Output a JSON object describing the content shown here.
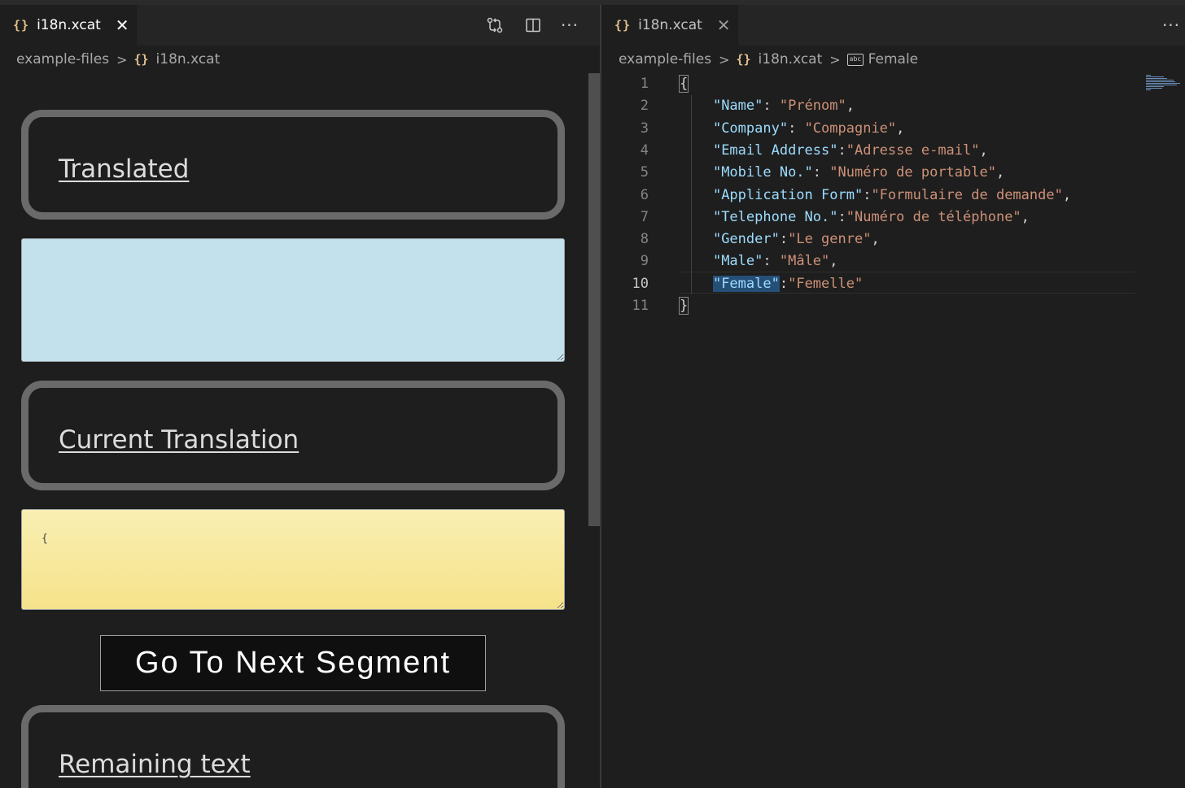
{
  "left": {
    "tab": {
      "icon": "json-braces-icon",
      "glyph": "{}",
      "label": "i18n.xcat",
      "close": "✕"
    },
    "actions": {
      "more": "···"
    },
    "breadcrumb": {
      "folder": "example-files",
      "file": "i18n.xcat",
      "separator": ">"
    },
    "webview": {
      "translated_label": "Translated",
      "translated_value": "",
      "current_label": "Current Translation",
      "current_value": "{",
      "next_button": "Go To Next Segment",
      "remaining_label": "Remaining text"
    }
  },
  "right": {
    "tab": {
      "icon": "json-braces-icon",
      "glyph": "{}",
      "label": "i18n.xcat",
      "close": "✕"
    },
    "actions": {
      "more": "···"
    },
    "breadcrumb": {
      "folder": "example-files",
      "file": "i18n.xcat",
      "symbol": "Female",
      "symbol_icon_text": "abc",
      "separator": ">"
    },
    "editor": {
      "current_line": 10,
      "lines": [
        {
          "no": "1",
          "parts": [
            {
              "t": "{",
              "c": "brace"
            }
          ]
        },
        {
          "no": "2",
          "parts": [
            {
              "t": "    ",
              "c": "p"
            },
            {
              "t": "\"Name\"",
              "c": "k"
            },
            {
              "t": ": ",
              "c": "p"
            },
            {
              "t": "\"Prénom\"",
              "c": "s"
            },
            {
              "t": ",",
              "c": "p"
            }
          ]
        },
        {
          "no": "3",
          "parts": [
            {
              "t": "    ",
              "c": "p"
            },
            {
              "t": "\"Company\"",
              "c": "k"
            },
            {
              "t": ": ",
              "c": "p"
            },
            {
              "t": "\"Compagnie\"",
              "c": "s"
            },
            {
              "t": ",",
              "c": "p"
            }
          ]
        },
        {
          "no": "4",
          "parts": [
            {
              "t": "    ",
              "c": "p"
            },
            {
              "t": "\"Email Address\"",
              "c": "k"
            },
            {
              "t": ":",
              "c": "p"
            },
            {
              "t": "\"Adresse e-mail\"",
              "c": "s"
            },
            {
              "t": ",",
              "c": "p"
            }
          ]
        },
        {
          "no": "5",
          "parts": [
            {
              "t": "    ",
              "c": "p"
            },
            {
              "t": "\"Mobile No.\"",
              "c": "k"
            },
            {
              "t": ": ",
              "c": "p"
            },
            {
              "t": "\"Numéro de portable\"",
              "c": "s"
            },
            {
              "t": ",",
              "c": "p"
            }
          ]
        },
        {
          "no": "6",
          "parts": [
            {
              "t": "    ",
              "c": "p"
            },
            {
              "t": "\"Application Form\"",
              "c": "k"
            },
            {
              "t": ":",
              "c": "p"
            },
            {
              "t": "\"Formulaire de demande\"",
              "c": "s"
            },
            {
              "t": ",",
              "c": "p"
            }
          ]
        },
        {
          "no": "7",
          "parts": [
            {
              "t": "    ",
              "c": "p"
            },
            {
              "t": "\"Telephone No.\"",
              "c": "k"
            },
            {
              "t": ":",
              "c": "p"
            },
            {
              "t": "\"Numéro de téléphone\"",
              "c": "s"
            },
            {
              "t": ",",
              "c": "p"
            }
          ]
        },
        {
          "no": "8",
          "parts": [
            {
              "t": "    ",
              "c": "p"
            },
            {
              "t": "\"Gender\"",
              "c": "k"
            },
            {
              "t": ":",
              "c": "p"
            },
            {
              "t": "\"Le genre\"",
              "c": "s"
            },
            {
              "t": ",",
              "c": "p"
            }
          ]
        },
        {
          "no": "9",
          "parts": [
            {
              "t": "    ",
              "c": "p"
            },
            {
              "t": "\"Male\"",
              "c": "k"
            },
            {
              "t": ": ",
              "c": "p"
            },
            {
              "t": "\"Mâle\"",
              "c": "s"
            },
            {
              "t": ",",
              "c": "p"
            }
          ]
        },
        {
          "no": "10",
          "parts": [
            {
              "t": "    ",
              "c": "p"
            },
            {
              "t": "\"Female\"",
              "c": "k k-hl"
            },
            {
              "t": ":",
              "c": "p"
            },
            {
              "t": "\"Femelle\"",
              "c": "s"
            }
          ]
        },
        {
          "no": "11",
          "parts": [
            {
              "t": "}",
              "c": "brace"
            }
          ]
        }
      ]
    }
  },
  "colors": {
    "background": "#1e1e1e",
    "json_key": "#9cdcfe",
    "json_string": "#ce9178",
    "translated_box": "#c3e1ed",
    "current_box": "#f6e28a"
  }
}
